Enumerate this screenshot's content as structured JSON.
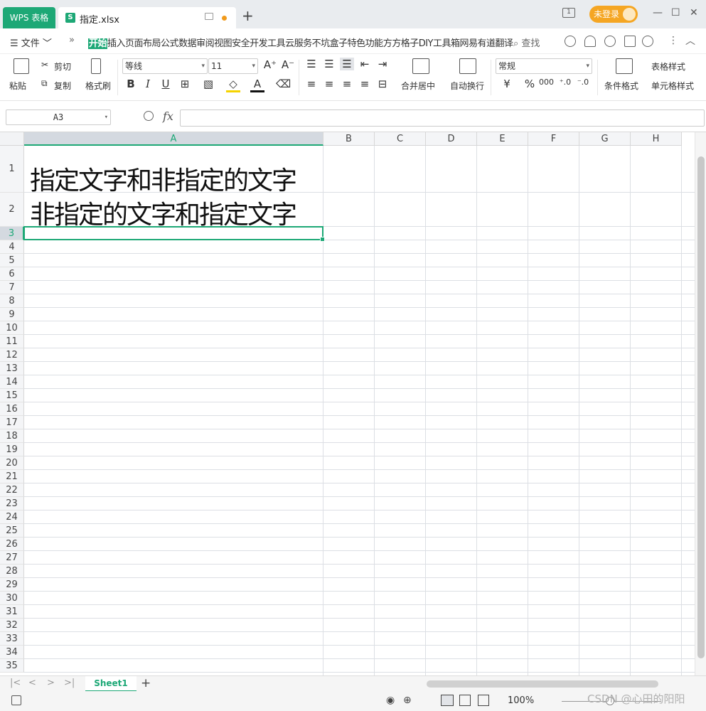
{
  "titlebar": {
    "app_tab": "WPS 表格",
    "doc_tab": "指定.xlsx",
    "doc_icon_letter": "S",
    "add_tab": "+",
    "page_indicator": "1",
    "login_label": "未登录",
    "minimize": "—",
    "maximize": "☐",
    "close": "✕"
  },
  "menubar": {
    "file": "☰ 文件 ﹀",
    "more": "»",
    "items": [
      "开始",
      "插入",
      "页面布局",
      "公式",
      "数据",
      "审阅",
      "视图",
      "安全",
      "开发工具",
      "云服务",
      "不坑盒子",
      "特色功能",
      "方方格子",
      "DIY工具箱",
      "网易有道翻译"
    ],
    "search": "查找",
    "overflow": "⋮",
    "collapse": "︿"
  },
  "ribbon": {
    "paste": "粘贴",
    "cut": "剪切",
    "copy": "复制",
    "format_painter": "格式刷",
    "font_name": "等线",
    "font_size": "11",
    "bold": "B",
    "italic": "I",
    "underline": "U",
    "font_color_letter": "A",
    "merge_center": "合并居中",
    "wrap_text": "自动换行",
    "number_format": "常规",
    "currency": "¥",
    "percent": "%",
    "thousands": "000",
    "cond_format": "条件格式",
    "table_style": "表格样式",
    "cell_style": "单元格样式"
  },
  "formulabar": {
    "name_box": "A3",
    "fx": "fx",
    "formula": ""
  },
  "grid": {
    "columns": [
      "A",
      "B",
      "C",
      "D",
      "E",
      "F",
      "G",
      "H"
    ],
    "active_column": "A",
    "active_row": "3",
    "rows": [
      "1",
      "2",
      "3",
      "4",
      "5",
      "6",
      "7",
      "8",
      "9",
      "10",
      "11",
      "12",
      "13",
      "14",
      "15",
      "16",
      "17",
      "18",
      "19",
      "20",
      "21",
      "22",
      "23",
      "24",
      "25",
      "26",
      "27",
      "28",
      "29",
      "30",
      "31",
      "32",
      "33",
      "34",
      "35"
    ],
    "cells": {
      "A1": "指定文字和非指定的文字",
      "A2": "非指定的文字和指定文字"
    }
  },
  "sheets": {
    "tabs": [
      "Sheet1"
    ],
    "active": "Sheet1",
    "add": "+"
  },
  "status": {
    "zoom": "100%",
    "watermark": "CSDN @心田的阳阳"
  },
  "colors": {
    "accent": "#1da876",
    "login": "#f5a623"
  }
}
